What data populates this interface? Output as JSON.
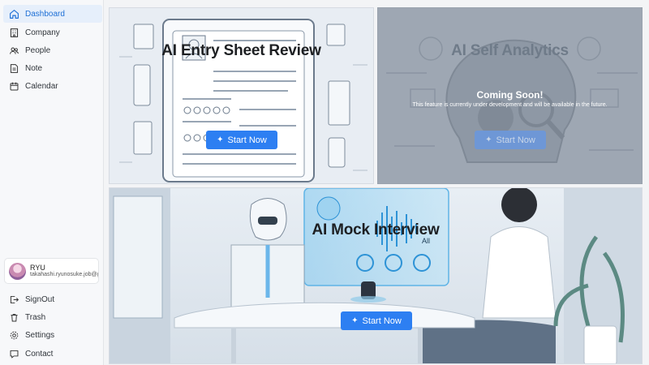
{
  "sidebar": {
    "nav": [
      {
        "label": "Dashboard",
        "icon": "home-icon",
        "active": true
      },
      {
        "label": "Company",
        "icon": "building-icon"
      },
      {
        "label": "People",
        "icon": "people-icon"
      },
      {
        "label": "Note",
        "icon": "note-icon"
      },
      {
        "label": "Calendar",
        "icon": "calendar-icon"
      }
    ],
    "user": {
      "name": "RYU",
      "email": "takahashi.ryunosuke.job@g"
    },
    "bottom": [
      {
        "label": "SignOut",
        "icon": "signout-icon"
      },
      {
        "label": "Trash",
        "icon": "trash-icon"
      },
      {
        "label": "Settings",
        "icon": "gear-icon"
      },
      {
        "label": "Contact",
        "icon": "chat-icon"
      }
    ]
  },
  "cards": {
    "entry_sheet": {
      "title": "AI Entry Sheet Review",
      "button": "Start Now"
    },
    "self_analytics": {
      "title": "AI Self Analytics",
      "coming": "Coming Soon!",
      "description": "This feature is currently under development and will be available in the future.",
      "button": "Start Now"
    },
    "mock_interview": {
      "title": "AI Mock Interview",
      "button": "Start Now",
      "screen_text": "All"
    }
  },
  "colors": {
    "accent": "#2d7ff2",
    "active_bg": "#e6effb",
    "active_text": "#1d6fd6"
  }
}
